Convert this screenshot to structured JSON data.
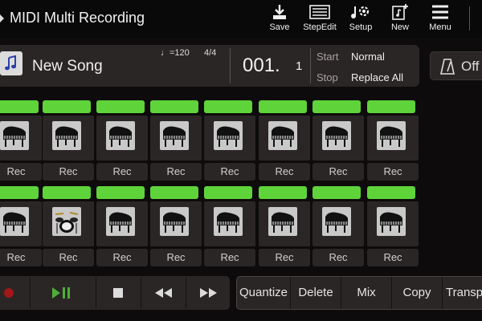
{
  "header": {
    "title": "MIDI Multi Recording",
    "toolbar": [
      {
        "label": "Save",
        "icon": "save-icon"
      },
      {
        "label": "StepEdit",
        "icon": "step-edit-icon"
      },
      {
        "label": "Setup",
        "icon": "setup-icon"
      },
      {
        "label": "New",
        "icon": "new-song-icon"
      },
      {
        "label": "Menu",
        "icon": "menu-icon"
      }
    ]
  },
  "song": {
    "name": "New Song",
    "tempo": "♩=120",
    "time_signature": "4/4",
    "measure": "001.",
    "beat": "1",
    "start_label": "Start",
    "start_value": "Normal",
    "stop_label": "Stop",
    "stop_value": "Replace All"
  },
  "metronome": {
    "label": "Off"
  },
  "tracks": [
    {
      "row": 1,
      "instrument": "piano-icon",
      "rec_label": "Rec"
    },
    {
      "row": 1,
      "instrument": "piano-icon",
      "rec_label": "Rec"
    },
    {
      "row": 1,
      "instrument": "piano-icon",
      "rec_label": "Rec"
    },
    {
      "row": 1,
      "instrument": "piano-icon",
      "rec_label": "Rec"
    },
    {
      "row": 1,
      "instrument": "piano-icon",
      "rec_label": "Rec"
    },
    {
      "row": 1,
      "instrument": "piano-icon",
      "rec_label": "Rec"
    },
    {
      "row": 1,
      "instrument": "piano-icon",
      "rec_label": "Rec"
    },
    {
      "row": 1,
      "instrument": "piano-icon",
      "rec_label": "Rec"
    },
    {
      "row": 2,
      "instrument": "piano-icon",
      "rec_label": "Rec"
    },
    {
      "row": 2,
      "instrument": "drum-kit-icon",
      "rec_label": "Rec"
    },
    {
      "row": 2,
      "instrument": "piano-icon",
      "rec_label": "Rec"
    },
    {
      "row": 2,
      "instrument": "piano-icon",
      "rec_label": "Rec"
    },
    {
      "row": 2,
      "instrument": "piano-icon",
      "rec_label": "Rec"
    },
    {
      "row": 2,
      "instrument": "piano-icon",
      "rec_label": "Rec"
    },
    {
      "row": 2,
      "instrument": "piano-icon",
      "rec_label": "Rec"
    },
    {
      "row": 2,
      "instrument": "piano-icon",
      "rec_label": "Rec"
    }
  ],
  "transport": {
    "record": "record-icon",
    "play_pause": "play-pause-icon",
    "stop": "stop-icon",
    "rewind": "rewind-icon",
    "fast_forward": "fast-forward-icon"
  },
  "edit_buttons": [
    {
      "label": "Quantize"
    },
    {
      "label": "Delete"
    },
    {
      "label": "Mix"
    },
    {
      "label": "Copy"
    },
    {
      "label": "Transpose"
    }
  ],
  "colors": {
    "track_bar": "#5fd33a",
    "record": "#a01818",
    "play": "#4fae3a",
    "panel": "#2b2626",
    "background": "#0d0b0b"
  }
}
